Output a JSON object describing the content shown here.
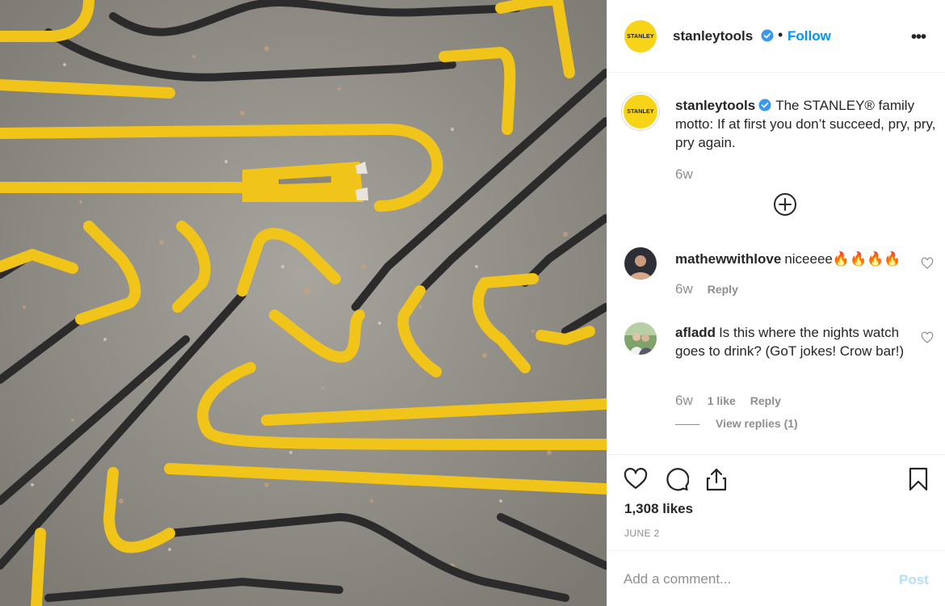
{
  "post": {
    "image_alt": "Yellow and black STANLEY pry bars scattered on dusty concrete"
  },
  "header": {
    "avatar_label": "STANLEY",
    "username": "stanleytools",
    "dot": "•",
    "follow_label": "Follow",
    "more_label": "•••"
  },
  "caption": {
    "avatar_label": "STANLEY",
    "username": "stanleytools",
    "text": "The STANLEY® family motto: If at first you don’t succeed, pry, pry, pry again.",
    "time": "6w"
  },
  "comments": [
    {
      "username": "mathewwithlove",
      "text": "niceeee🔥🔥🔥🔥",
      "time": "6w",
      "reply_label": "Reply"
    },
    {
      "username": "afladd",
      "text": "Is this where the nights watch goes to drink? (GoT jokes! Crow bar!)",
      "time": "6w",
      "likes_label": "1 like",
      "reply_label": "Reply",
      "view_replies_label": "View replies (1)"
    }
  ],
  "actions": {
    "likes": "1,308 likes",
    "date": "JUNE 2"
  },
  "comment_box": {
    "placeholder": "Add a comment...",
    "post_label": "Post"
  },
  "colors": {
    "accent": "#0095f6",
    "post_disabled": "#b2dffc",
    "brand_yellow": "#f7d417",
    "secondary_text": "#8e8e8e"
  }
}
